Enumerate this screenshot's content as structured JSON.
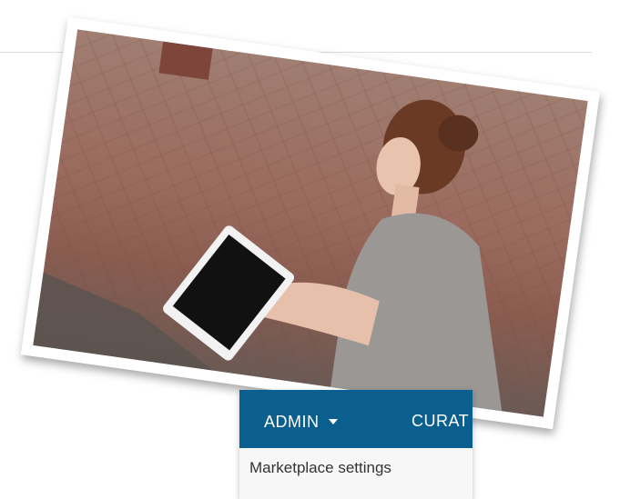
{
  "nav": {
    "admin_label": "ADMIN",
    "curat_label": "CURAT",
    "bar_color": "#0b5f8f"
  },
  "dropdown": {
    "items": [
      "Marketplace settings"
    ]
  },
  "photo": {
    "subject": "woman reading tablet on brick pavement"
  }
}
